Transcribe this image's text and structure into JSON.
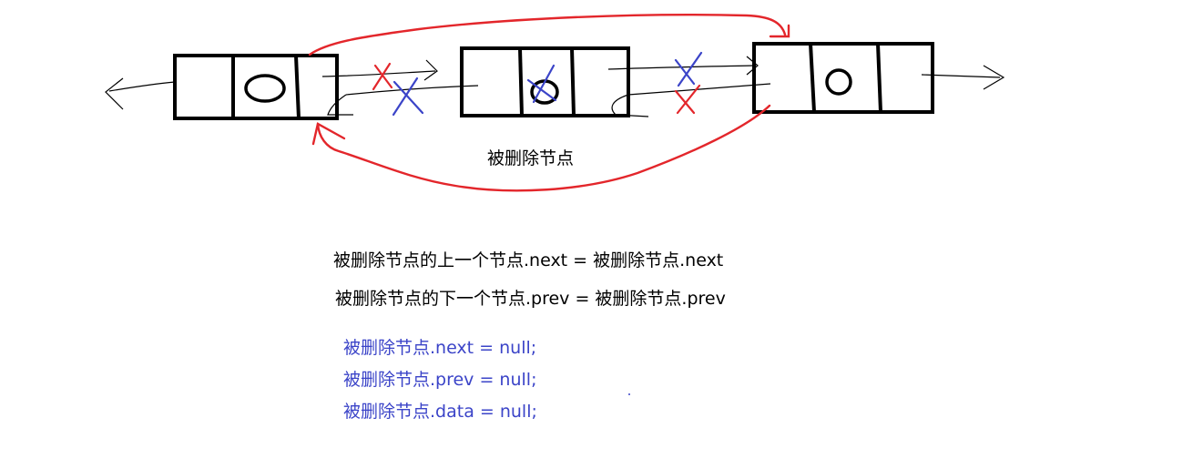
{
  "diagram": {
    "deleted_node_label": "被删除节点",
    "formulas": [
      "被删除节点的上一个节点.next = 被删除节点.next",
      "被删除节点的下一个节点.prev = 被删除节点.prev"
    ],
    "cleanup_code": [
      "被删除节点.next = null;",
      "被删除节点.prev = null;",
      "被删除节点.data = null;"
    ]
  },
  "colors": {
    "ink": "#000000",
    "new_links": "#e3262b",
    "removed_mark_red": "#e3262b",
    "removed_mark_blue": "#3b44c8",
    "code_text": "#3b44c8"
  }
}
